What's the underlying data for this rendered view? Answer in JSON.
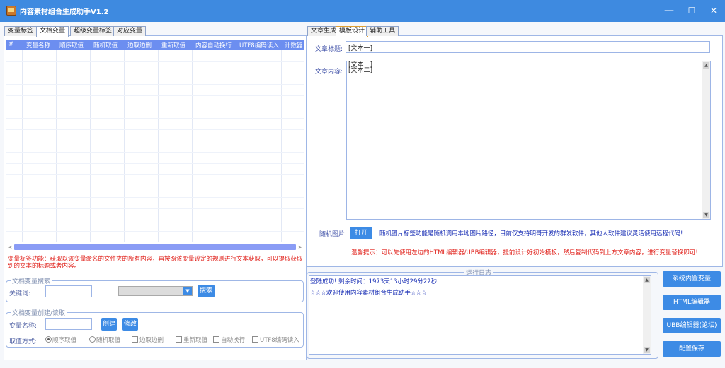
{
  "window": {
    "title": "内容素材组合生成助手V1.2",
    "min_glyph": "—",
    "max_glyph": "☐",
    "close_glyph": "✕"
  },
  "left_tabs": [
    "变量标签",
    "文档变量",
    "超级变量标签",
    "对应变量"
  ],
  "grid": {
    "columns": [
      "#",
      "变量名称",
      "顺序取值",
      "随机取值",
      "边取边删",
      "重新取值",
      "内容自动换行",
      "UTF8编码读入",
      "计数器"
    ]
  },
  "scroll_left": "<",
  "scroll_right": ">",
  "scroll_up": "▲",
  "scroll_down": "▼",
  "notice": "变量标签功能：获取以该变量命名的文件夹的所有内容，再按照该变量设定的规则进行文本获取，可以提取获取到的文本的标题或者内容。",
  "search_group": {
    "legend": "文档变量搜索",
    "keyword_label": "关键词:",
    "keyword_value": "",
    "search_button": "搜索"
  },
  "create_group": {
    "legend": "文档变量创建/读取",
    "name_label": "变量名称:",
    "name_value": "",
    "create_button": "创建",
    "modify_button": "修改",
    "mode_label": "取值方式:",
    "options": [
      "顺序取值",
      "随机取值",
      "边取边删",
      "重新取值",
      "自动换行",
      "UTF8编码读入"
    ]
  },
  "right_tabs": [
    "文章生成",
    "模板设计",
    "辅助工具"
  ],
  "template": {
    "title_label": "文章标题:",
    "title_value": "[文本一]",
    "content_label": "文章内容:",
    "content_lines": [
      "[文本一]",
      "[文本二]"
    ],
    "image_label": "随机图片:",
    "open_button": "打开",
    "image_hint": "随机图片标签功能是随机调用本地图片路径，目前仅支持明哥开发的群发软件，其他人软件建议灵活使用远程代码!",
    "tip": "温馨提示：可以先使用左边的HTML编辑器/UBB编辑器，提前设计好初始模板，然后复制代码到上方文章内容，进行变量替换即可!"
  },
  "log": {
    "legend": "运行日志",
    "lines": [
      "登陆成功! 剩余时间：1973天13小时29分22秒",
      "☆☆☆欢迎使用内容素材组合生成助手☆☆☆"
    ]
  },
  "side_buttons": [
    "系统内置变量",
    "HTML编辑器",
    "UBB编辑器(论坛)",
    "配置保存"
  ],
  "colors": {
    "titlebar": "#3e8ae0",
    "accent": "#3d8be5",
    "grid_header": "#6c8ef0",
    "warning": "#e0201a"
  }
}
